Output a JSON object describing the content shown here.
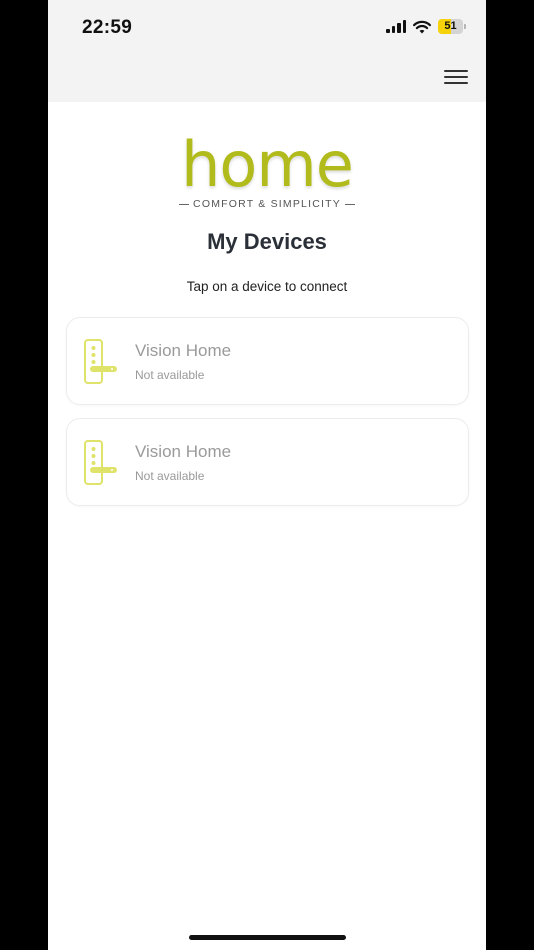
{
  "status_bar": {
    "time": "22:59",
    "battery_level": "51",
    "battery_fraction": 0.51,
    "icons": [
      "cellular-signal-icon",
      "wifi-icon",
      "battery-icon"
    ]
  },
  "nav": {
    "menu_icon": "hamburger-menu-icon"
  },
  "logo": {
    "word": "home",
    "tagline": "COMFORT & SIMPLICITY"
  },
  "page": {
    "title": "My Devices",
    "subtitle": "Tap on a device to connect"
  },
  "devices": [
    {
      "name": "Vision Home",
      "status": "Not available",
      "icon": "smart-lock-icon"
    },
    {
      "name": "Vision Home",
      "status": "Not available",
      "icon": "smart-lock-icon"
    }
  ],
  "colors": {
    "brand": "#b1bb1c",
    "lock_icon": "#dfe36a",
    "header_bg": "#f3f3f3",
    "battery_fill": "#f5d20a",
    "muted_text": "#9a9a9a"
  }
}
